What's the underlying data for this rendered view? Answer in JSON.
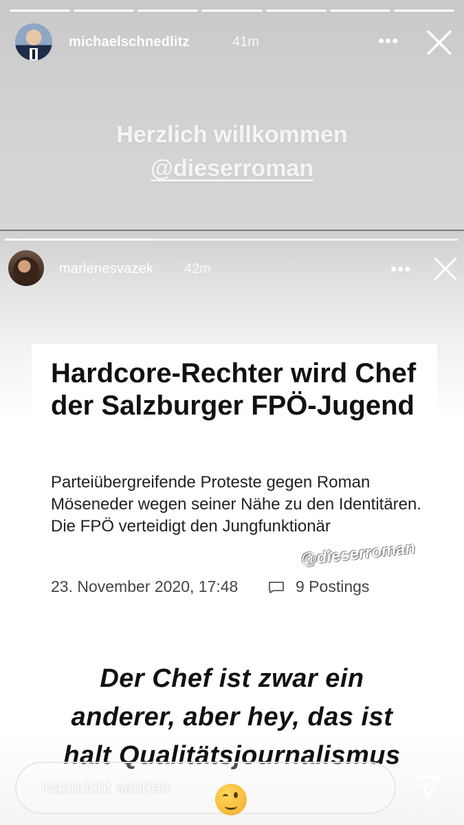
{
  "story_top": {
    "progress_segments": 7,
    "username": "michaelschnedlitz",
    "time": "41m",
    "more_label": "•••",
    "text_line1": "Herzlich willkommen",
    "text_line2": "@dieserroman"
  },
  "story_bottom": {
    "progress_fraction": 0.33,
    "username": "marlenesvazek",
    "time": "42m",
    "more_label": "•••",
    "article": {
      "headline": "Hardcore-Rechter wird Chef der Salzburger FPÖ-Jugend",
      "lead": "Parteiübergreifende Proteste gegen Roman Möseneder wegen seiner Nähe zu den Identitären. Die FPÖ verteidigt den Jungfunktionär",
      "date": "23. November 2020, 17:48",
      "postings": "9 Postings"
    },
    "mention_sticker": "@dieserroman",
    "caption_line1": "Der Chef ist zwar ein",
    "caption_line2": "anderer, aber hey, das ist",
    "caption_line3": "halt Qualitätsjournalismus"
  },
  "reply": {
    "placeholder": "Nachricht senden"
  },
  "icons": {
    "close": "close-icon",
    "more": "more-icon",
    "send": "send-icon",
    "comment": "comment-icon",
    "emoji": "winking-face-emoji"
  }
}
